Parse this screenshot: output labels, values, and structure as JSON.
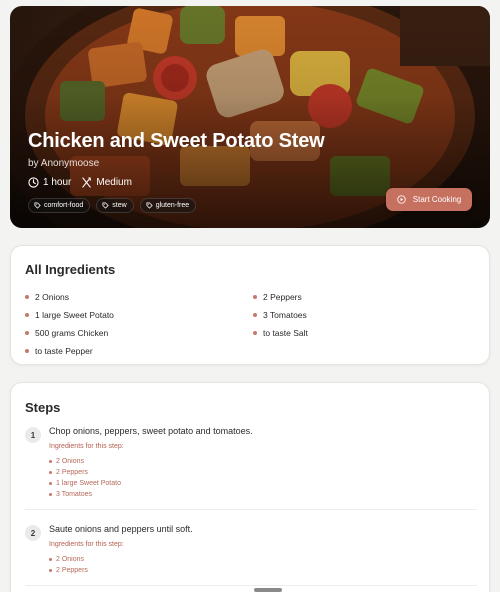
{
  "recipe": {
    "title": "Chicken and Sweet Potato Stew",
    "author": "by Anonymoose",
    "time": "1 hour",
    "difficulty": "Medium",
    "tags": [
      "comfort-food",
      "stew",
      "gluten-free"
    ],
    "start_label": "Start Cooking"
  },
  "ingredients": {
    "heading": "All Ingredients",
    "items": [
      "2 Onions",
      "2 Peppers",
      "1 large Sweet Potato",
      "3 Tomatoes",
      "500 grams Chicken",
      "to taste Salt",
      "to taste Pepper"
    ]
  },
  "steps": {
    "heading": "Steps",
    "list": [
      {
        "number": "1",
        "text": "Chop onions, peppers, sweet potato and tomatoes.",
        "ingredients_label": "Ingredients for this step:",
        "ingredients": [
          "2 Onions",
          "2 Peppers",
          "1 large Sweet Potato",
          "3 Tomatoes"
        ]
      },
      {
        "number": "2",
        "text": "Saute onions and peppers until soft.",
        "ingredients_label": "Ingredients for this step:",
        "ingredients": [
          "2 Onions",
          "2 Peppers"
        ]
      }
    ]
  },
  "colors": {
    "accent": "#c67060",
    "accent_text": "#b56050",
    "background": "#f3f3f1"
  },
  "icons": {
    "time": "clock-icon",
    "difficulty": "utensils-icon",
    "tag": "tag-icon",
    "start": "play-circle-icon"
  }
}
